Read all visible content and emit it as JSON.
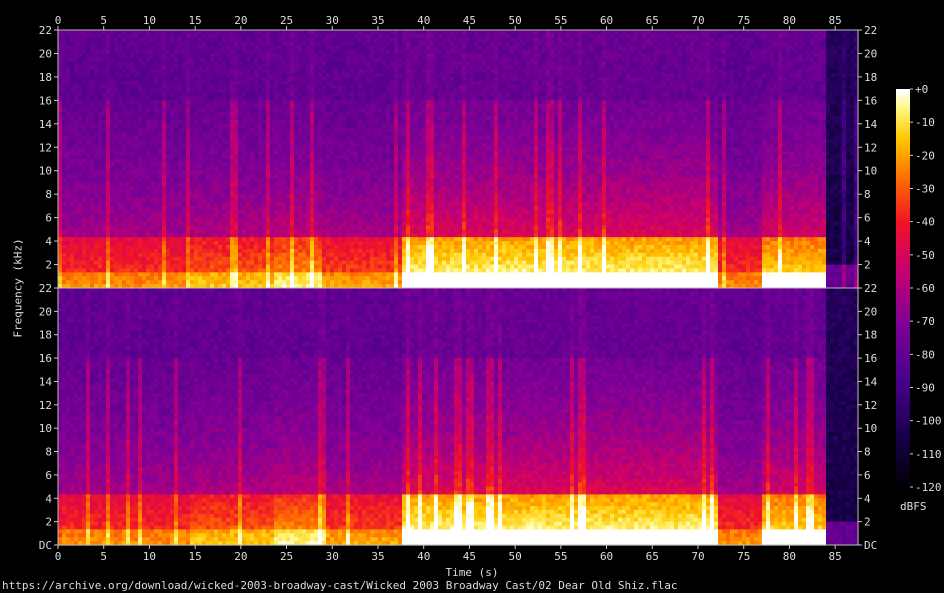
{
  "chart_data": {
    "type": "heatmap",
    "title": "",
    "xlabel": "Time (s)",
    "ylabel": "Frequency (kHz)",
    "colorbar_label": "dBFS",
    "source_url": "https://archive.org/download/wicked-2003-broadway-cast/Wicked 2003 Broadway Cast/02 Dear Old Shiz.flac",
    "xlim": [
      0,
      87.5
    ],
    "ylim": [
      0,
      22
    ],
    "x_ticks": [
      0,
      5,
      10,
      15,
      20,
      25,
      30,
      35,
      40,
      45,
      50,
      55,
      60,
      65,
      70,
      75,
      80,
      85
    ],
    "x_tick_labels": [
      "0",
      "5",
      "10",
      "15",
      "20",
      "25",
      "30",
      "35",
      "40",
      "45",
      "50",
      "55",
      "60",
      "65",
      "70",
      "75",
      "80",
      "85"
    ],
    "y_ticks": [
      0,
      2,
      4,
      6,
      8,
      10,
      12,
      14,
      16,
      18,
      20,
      22
    ],
    "y_tick_labels_top": [
      "22",
      "2",
      "4",
      "6",
      "8",
      "10",
      "12",
      "14",
      "16",
      "18",
      "20",
      "22"
    ],
    "y_tick_labels_bottom": [
      "DC",
      "2",
      "4",
      "6",
      "8",
      "10",
      "12",
      "14",
      "16",
      "18",
      "20",
      "22"
    ],
    "colorbar_range": [
      -120,
      0
    ],
    "colorbar_ticks": [
      "+0",
      "-10",
      "-20",
      "-30",
      "-40",
      "-50",
      "-60",
      "-70",
      "-80",
      "-90",
      "-100",
      "-110",
      "-120"
    ],
    "channels": [
      "top",
      "bottom"
    ],
    "loud_segments": [
      {
        "start": 0.5,
        "end": 14.5,
        "level": 0.55
      },
      {
        "start": 14.5,
        "end": 23.5,
        "level": 0.62
      },
      {
        "start": 23.5,
        "end": 29.0,
        "level": 0.7
      },
      {
        "start": 29.0,
        "end": 37.5,
        "level": 0.58
      },
      {
        "start": 37.5,
        "end": 72.0,
        "level": 0.9
      },
      {
        "start": 72.0,
        "end": 77.0,
        "level": 0.55
      },
      {
        "start": 77.0,
        "end": 84.0,
        "level": 0.82
      },
      {
        "start": 84.0,
        "end": 87.5,
        "level": 0.08
      }
    ],
    "cutoff_khz": 16
  }
}
